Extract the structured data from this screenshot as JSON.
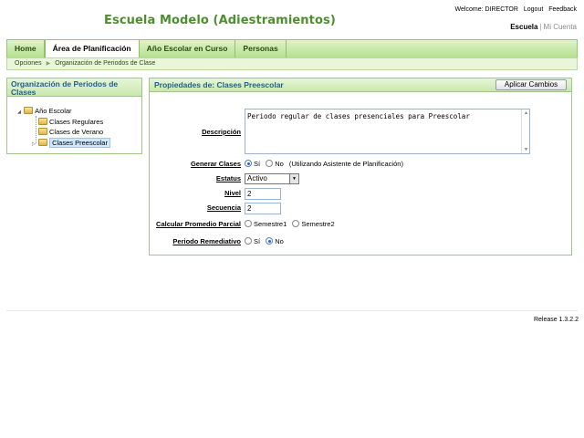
{
  "app": {
    "title": "Escuela Modelo (Adiestramientos)"
  },
  "header": {
    "welcome": "Welcome: DIRECTOR",
    "logout": "Logout",
    "feedback": "Feedback",
    "account_links": {
      "escuela": "Escuela",
      "mi_cuenta": "Mi Cuenta"
    }
  },
  "nav": {
    "tabs": [
      {
        "label": "Home"
      },
      {
        "label": "Área de Planificación"
      },
      {
        "label": "Año Escolar en Curso"
      },
      {
        "label": "Personas"
      }
    ],
    "active_tab": "Área de Planificación"
  },
  "breadcrumb": {
    "items": [
      "Opciones",
      "Organización de Periodos de Clase"
    ]
  },
  "left_panel": {
    "title": "Organización de Periodos de Clases",
    "tree": {
      "root": "Año Escolar",
      "children": [
        "Clases Regulares",
        "Clases de Verano",
        "Clases Preescolar"
      ],
      "selected": "Clases Preescolar"
    }
  },
  "right_panel": {
    "title": "Propiedades de: Clases Preescolar",
    "apply_button": "Aplicar Cambios",
    "form": {
      "descripcion": {
        "label": "Descripción",
        "value": "Periodo regular de clases presenciales para Preescolar"
      },
      "generar_clases": {
        "label": "Generar Clases",
        "options": [
          "Sí",
          "No"
        ],
        "selected": "Sí",
        "note": "(Utilizando Asistente de Planificación)"
      },
      "estatus": {
        "label": "Estatus",
        "value": "Activo"
      },
      "nivel": {
        "label": "Nivel",
        "value": "2"
      },
      "secuencia": {
        "label": "Secuencia",
        "value": "2"
      },
      "calcular_promedio": {
        "label": "Calcular Promedio Parcial",
        "options": [
          "Semestre1",
          "Semestre2"
        ],
        "selected": ""
      },
      "periodo_remediativo": {
        "label": "Periodo Remediativo",
        "options": [
          "Sí",
          "No"
        ],
        "selected": "No"
      }
    }
  },
  "footer": {
    "release": "Release 1.3.2.2"
  }
}
